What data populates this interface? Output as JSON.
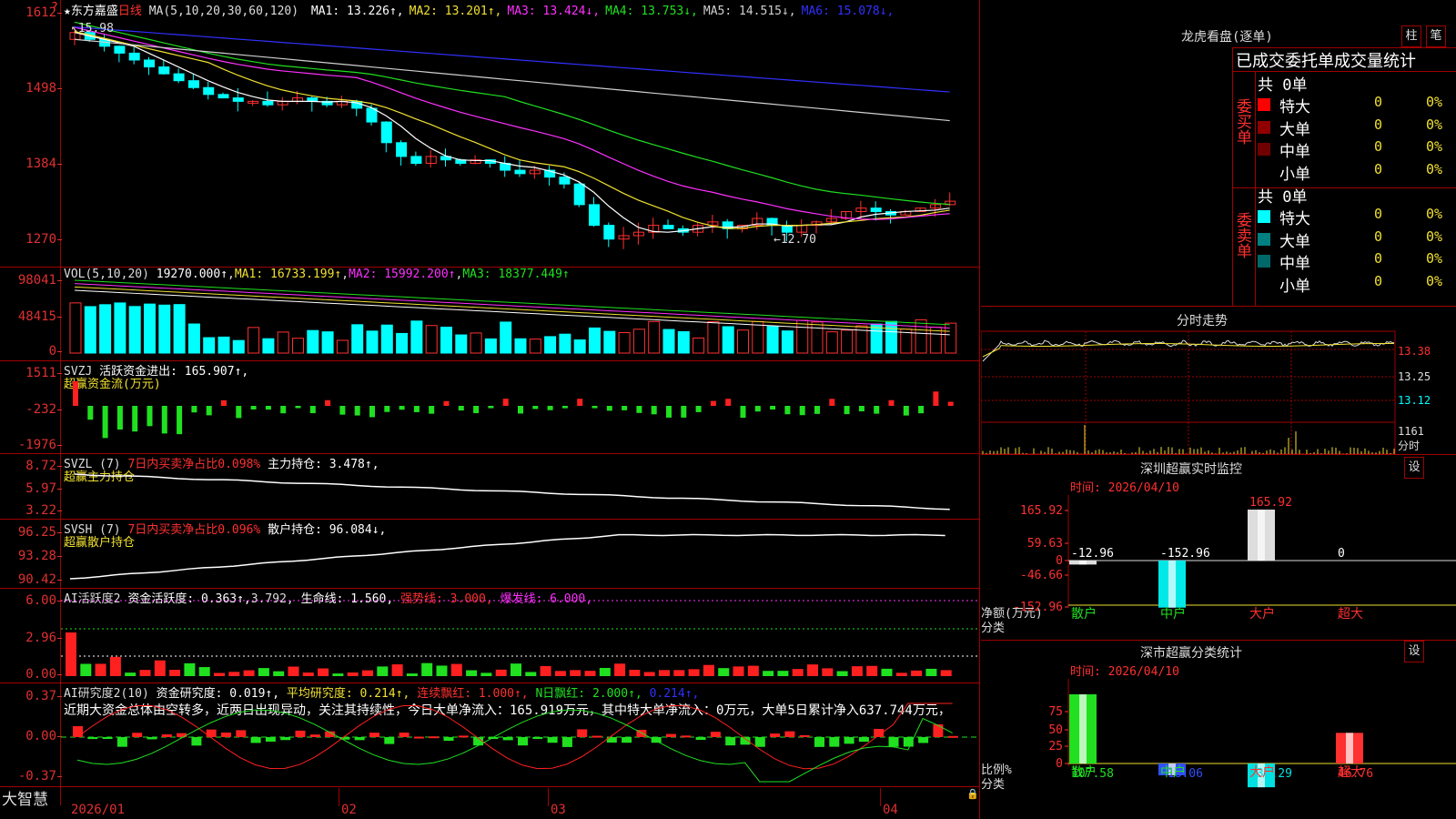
{
  "app_name": "大智慧",
  "stock": {
    "name": "东方嘉盛",
    "period": "日线"
  },
  "main_chart": {
    "ma_label": "MA(5,10,20,30,60,120)",
    "ma": [
      {
        "name": "MA1",
        "value": "13.226",
        "arrow": "↑",
        "color": "#ffffff"
      },
      {
        "name": "MA2",
        "value": "13.201",
        "arrow": "↑",
        "color": "#f0e030"
      },
      {
        "name": "MA3",
        "value": "13.424",
        "arrow": "↓",
        "color": "#ff30ff"
      },
      {
        "name": "MA4",
        "value": "13.753",
        "arrow": "↓",
        "color": "#20e020"
      },
      {
        "name": "MA5",
        "value": "14.515",
        "arrow": "↓",
        "color": "#d0d0d0"
      },
      {
        "name": "MA6",
        "value": "15.078",
        "arrow": "↓",
        "color": "#3030ff"
      }
    ],
    "y_ticks": [
      "1612",
      "1498",
      "1384",
      "1270"
    ],
    "high_label": "15.98",
    "low_label": "12.70"
  },
  "vol_panel": {
    "label": "VOL(5,10,20)",
    "value": "19270.000↑",
    "ma1": "MA1: 16733.199↑",
    "ma2": "MA2: 15992.200↑",
    "ma3": "MA3: 18377.449↑",
    "y_ticks": [
      "98041",
      "48415",
      "0"
    ]
  },
  "svzj_panel": {
    "label": "SVZJ",
    "text1": "活跃资金进出: 165.907↑,",
    "sub": "超赢资金流(万元)",
    "y_ticks": [
      "1511",
      "-232",
      "-1976"
    ]
  },
  "svzl_panel": {
    "label": "SVZL (7)",
    "red": "7日内买卖净占比0.098%",
    "text": "主力持仓: 3.478↑,",
    "sub": "超赢主力持仓",
    "y_ticks": [
      "8.72",
      "5.97",
      "3.22"
    ]
  },
  "svsh_panel": {
    "label": "SVSH (7)",
    "red": "7日内买卖净占比0.096%",
    "text": "散户持仓: 96.084↓,",
    "sub": "超赢散户持仓",
    "y_ticks": [
      "96.25",
      "93.28",
      "90.42"
    ]
  },
  "ai_active_panel": {
    "label": "AI活跃度2",
    "t1": "资金活跃度: 0.363↑,",
    "t2": "3.792,",
    "t3": "生命线: 1.560,",
    "t4": "强势线: 3.000,",
    "t5": "爆发线: 6.000,",
    "y_ticks": [
      "6.00",
      "2.96",
      "0.00"
    ]
  },
  "ai_research_panel": {
    "label": "AI研究度2(10)",
    "t1": "资金研究度: 0.019↑,",
    "t2": "平均研究度: 0.214↑,",
    "t3": "连续飘红: 1.000↑,",
    "t4": "N日飘红: 2.000↑,",
    "t5": "0.214↑,",
    "note": "近期大资金总体由空转多，近两日出现异动，关注其持续性，今日大单净流入：165.919万元，其中特大单净流入：0万元，大单5日累计净入637.744万元，",
    "y_ticks": [
      "0.37",
      "0.00",
      "-0.37"
    ]
  },
  "x_labels": [
    "2026/01",
    "02",
    "03",
    "04"
  ],
  "right_panel": {
    "dragon_title": "龙虎看盘(逐单)",
    "btn_zhu": "柱",
    "btn_bi": "笔",
    "stats_title": "已成交委托单成交量统计",
    "buy_side": {
      "side": "委买单",
      "total": "共 0单",
      "rows": [
        {
          "label": "特大",
          "count": "0",
          "pct": "0%",
          "color": "#ff0000"
        },
        {
          "label": "大单",
          "count": "0",
          "pct": "0%",
          "color": "#900000"
        },
        {
          "label": "中单",
          "count": "0",
          "pct": "0%",
          "color": "#700000"
        },
        {
          "label": "小单",
          "count": "0",
          "pct": "0%",
          "color": ""
        }
      ]
    },
    "sell_side": {
      "side": "委卖单",
      "total": "共 0单",
      "rows": [
        {
          "label": "特大",
          "count": "0",
          "pct": "0%",
          "color": "#00ffff"
        },
        {
          "label": "大单",
          "count": "0",
          "pct": "0%",
          "color": "#008080"
        },
        {
          "label": "中单",
          "count": "0",
          "pct": "0%",
          "color": "#006868"
        },
        {
          "label": "小单",
          "count": "0",
          "pct": "0%",
          "color": ""
        }
      ]
    },
    "intraday_title": "分时走势",
    "intraday_ticks": [
      "13.38",
      "13.25",
      "13.12",
      "1161",
      "分时"
    ],
    "monitor": {
      "title": "深圳超赢实时监控",
      "btn": "设",
      "date": "时间: 2026/04/10",
      "y_ticks": [
        "165.92",
        "59.63",
        "0",
        "-46.66",
        "-152.96"
      ],
      "values": [
        "-12.96",
        "-152.96",
        "165.92",
        "0"
      ],
      "categories": [
        "散户",
        "中户",
        "大户",
        "超大"
      ],
      "axis_label": "净额(万元)",
      "cat_label": "分类"
    },
    "classify": {
      "title": "深市超赢分类统计",
      "btn": "设",
      "date": "时间: 2026/04/10",
      "y_ticks": [
        "75",
        "50",
        "25",
        "0"
      ],
      "values": [
        "107.58",
        "-18.06",
        "-36.29",
        "46.76"
      ],
      "categories": [
        "散户",
        "中户",
        "大户",
        "超大"
      ],
      "axis_label": "比例%",
      "cat_label": "分类"
    }
  },
  "chart_data": [
    {
      "type": "bar",
      "title": "深圳超赢实时监控",
      "ylabel": "净额(万元)",
      "categories": [
        "散户",
        "中户",
        "大户",
        "超大"
      ],
      "values": [
        -12.96,
        -152.96,
        165.92,
        0
      ],
      "ylim": [
        -152.96,
        165.92
      ]
    },
    {
      "type": "bar",
      "title": "深市超赢分类统计",
      "ylabel": "比例%",
      "categories": [
        "散户",
        "中户",
        "大户",
        "超大"
      ],
      "values": [
        107.58,
        -18.06,
        -36.29,
        46.76
      ],
      "ylim": [
        0,
        75
      ]
    }
  ]
}
